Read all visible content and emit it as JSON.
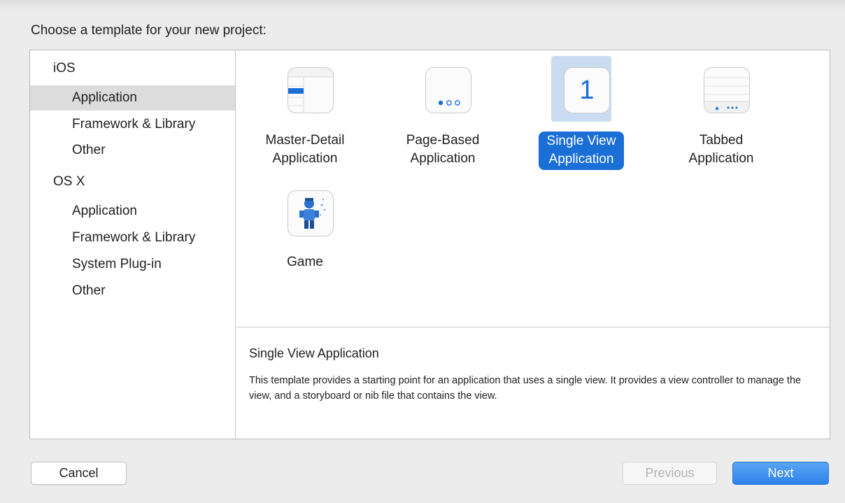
{
  "heading": "Choose a template for your new project:",
  "sidebar": {
    "rows": [
      {
        "label": "iOS",
        "kind": "group"
      },
      {
        "label": "Application",
        "kind": "item",
        "selected": true
      },
      {
        "label": "Framework & Library",
        "kind": "item"
      },
      {
        "label": "Other",
        "kind": "item"
      },
      {
        "label": "OS X",
        "kind": "group"
      },
      {
        "label": "Application",
        "kind": "item"
      },
      {
        "label": "Framework & Library",
        "kind": "item"
      },
      {
        "label": "System Plug-in",
        "kind": "item"
      },
      {
        "label": "Other",
        "kind": "item"
      }
    ]
  },
  "templates": [
    {
      "line1": "Master-Detail",
      "line2": "Application",
      "icon": "master-detail-icon"
    },
    {
      "line1": "Page-Based",
      "line2": "Application",
      "icon": "page-based-icon"
    },
    {
      "line1": "Single View",
      "line2": "Application",
      "icon": "single-view-icon",
      "icon_text": "1",
      "selected": true
    },
    {
      "line1": "Tabbed",
      "line2": "Application",
      "icon": "tabbed-icon"
    },
    {
      "line1": "Game",
      "line2": "",
      "icon": "game-icon"
    }
  ],
  "description": {
    "title": "Single View Application",
    "body": "This template provides a starting point for an application that uses a single view. It provides a view controller to manage the view, and a storyboard or nib file that contains the view."
  },
  "buttons": {
    "cancel": "Cancel",
    "previous": "Previous",
    "next": "Next"
  },
  "colors": {
    "accent": "#1a6fd6",
    "selection_bg": "#c9dcf2",
    "sidebar_selected": "#dcdcdc"
  }
}
